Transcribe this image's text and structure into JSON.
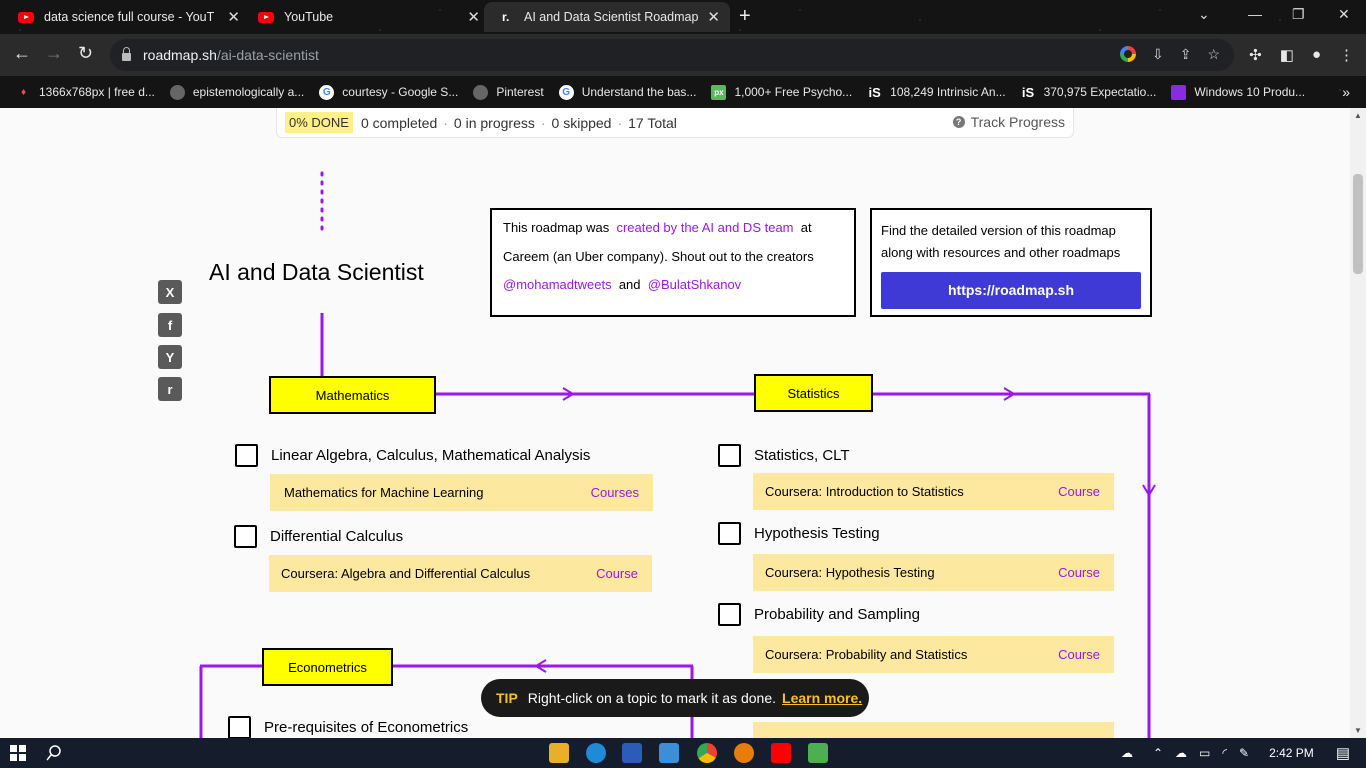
{
  "browser": {
    "tabs": [
      {
        "title": "data science full course - YouTube",
        "icon": "youtube-icon"
      },
      {
        "title": "YouTube",
        "icon": "youtube-icon"
      },
      {
        "title": "AI and Data Scientist Roadmap",
        "icon": "roadmap-icon",
        "active": true
      }
    ],
    "url_host": "roadmap.sh",
    "url_path": "/ai-data-scientist",
    "bookmarks": [
      {
        "label": "1366x768px | free d...",
        "color": "#e8552a"
      },
      {
        "label": "epistemologically a...",
        "color": "#888888"
      },
      {
        "label": "courtesy - Google S...",
        "color": "#4285f4"
      },
      {
        "label": "Pinterest",
        "color": "#888888"
      },
      {
        "label": "Understand the bas...",
        "color": "#4285f4"
      },
      {
        "label": "1,000+ Free Psycho...",
        "color": "#5cb85c"
      },
      {
        "label": "108,249 Intrinsic An...",
        "color": "#ffffff"
      },
      {
        "label": "370,975 Expectatio...",
        "color": "#ffffff"
      },
      {
        "label": "Windows 10 Produ...",
        "color": "#8a2be2"
      }
    ]
  },
  "progress": {
    "percent_done": "0% DONE",
    "completed": "0 completed",
    "in_progress": "0 in progress",
    "skipped": "0 skipped",
    "total": "17 Total",
    "track": "Track Progress"
  },
  "social": [
    "X",
    "f",
    "Y",
    "r"
  ],
  "roadmap": {
    "title": "AI and Data Scientist",
    "info": {
      "text1": "This roadmap was",
      "link1": "created by the AI and DS team",
      "text2": "at Careem (an Uber company). Shout out to the creators",
      "creator1": "@mohamadtweets",
      "and": "and",
      "creator2": "@BulatShkanov"
    },
    "detail": {
      "text": "Find the detailed version of this roadmap along with resources and other roadmaps",
      "button": "https://roadmap.sh"
    },
    "nodes": {
      "mathematics": "Mathematics",
      "statistics": "Statistics",
      "econometrics": "Econometrics"
    },
    "math_topics": [
      {
        "label": "Linear Algebra, Calculus, Mathematical Analysis",
        "resource": "Mathematics for Machine Learning",
        "link": "Courses"
      },
      {
        "label": "Differential Calculus",
        "resource": "Coursera: Algebra and Differential Calculus",
        "link": "Course"
      }
    ],
    "stats_topics": [
      {
        "label": "Statistics, CLT",
        "resource": "Coursera: Introduction to Statistics",
        "link": "Course"
      },
      {
        "label": "Hypothesis Testing",
        "resource": "Coursera: Hypothesis Testing",
        "link": "Course"
      },
      {
        "label": "Probability and Sampling",
        "resource": "Coursera: Probability and Statistics",
        "link": "Course"
      }
    ],
    "econ_topics": [
      {
        "label": "Pre-requisites of Econometrics"
      }
    ]
  },
  "tip": {
    "label": "TIP",
    "text": "Right-click on a topic to mark it as done.",
    "link": "Learn more."
  },
  "taskbar": {
    "time": "2:42 PM"
  },
  "colors": {
    "accent": "#9b18e6",
    "node": "#ffff00",
    "resource_bg": "#fde8a0",
    "button": "#3f3ad6"
  }
}
